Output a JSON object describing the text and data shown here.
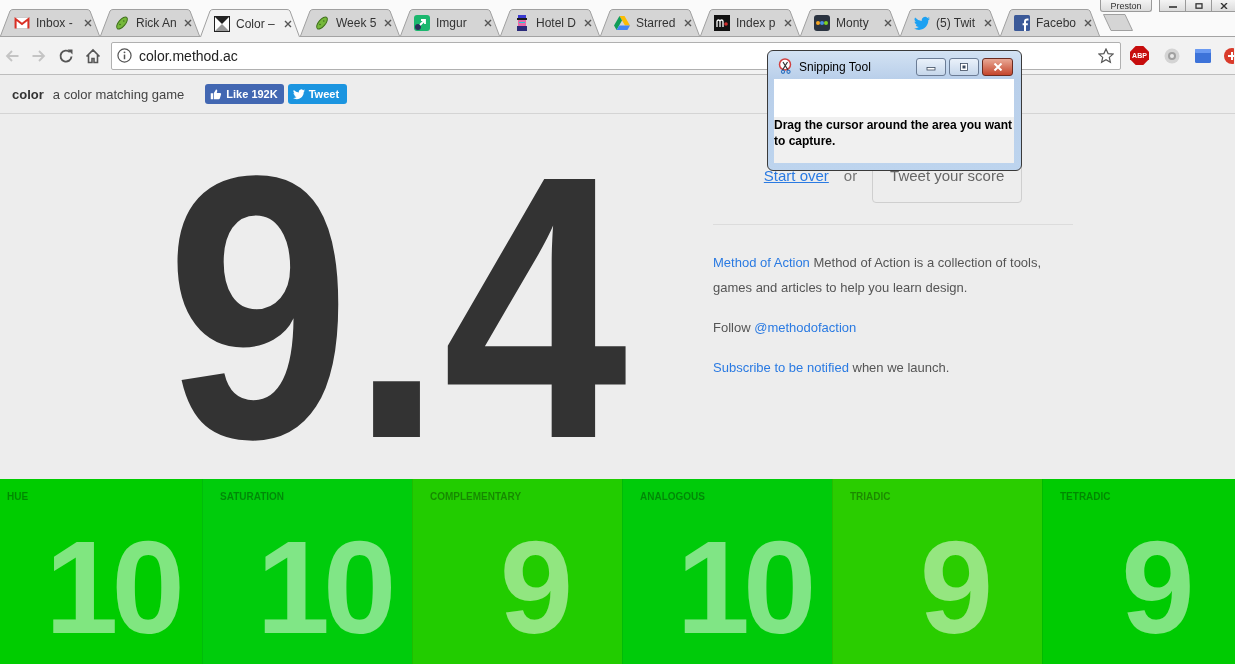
{
  "browser": {
    "tabs": [
      {
        "title": "Inbox -",
        "selected": false
      },
      {
        "title": "Rick An",
        "selected": false
      },
      {
        "title": "Color –",
        "selected": true
      },
      {
        "title": "Week 5",
        "selected": false
      },
      {
        "title": "Imgur",
        "selected": false
      },
      {
        "title": "Hotel D",
        "selected": false
      },
      {
        "title": "Starred",
        "selected": false
      },
      {
        "title": "Index p",
        "selected": false
      },
      {
        "title": "Monty",
        "selected": false
      },
      {
        "title": "(5) Twit",
        "selected": false
      },
      {
        "title": "Facebo",
        "selected": false
      }
    ],
    "profile": "Preston",
    "back": {
      "disabled": true
    },
    "forward": {
      "disabled": true
    },
    "address": "color.method.ac",
    "extension_label": "ABP"
  },
  "header": {
    "logo": "color",
    "tagline": "a color matching game",
    "like": {
      "label": "Like",
      "count": "192K"
    },
    "tweet": "Tweet"
  },
  "score": "9.4",
  "actions": {
    "start_over": "Start over",
    "separator": "or",
    "tweet_score": "Tweet your score"
  },
  "about": [
    {
      "parts": [
        {
          "kind": "link",
          "text": "Method of Action"
        },
        {
          "kind": "text",
          "text": "Method of Action is a collection of tools, games and articles to help you learn design."
        }
      ]
    },
    {
      "parts": [
        {
          "kind": "text",
          "text": "Follow"
        },
        {
          "kind": "link",
          "text": "@methodofaction"
        }
      ]
    },
    {
      "parts": [
        {
          "kind": "link",
          "text": "Subscribe to be notified"
        },
        {
          "kind": "text",
          "text": "when we launch."
        }
      ]
    }
  ],
  "scores": [
    {
      "label": "HUE",
      "value": "10",
      "color": "#00cc00"
    },
    {
      "label": "SATURATION",
      "value": "10",
      "color": "#00cc0c"
    },
    {
      "label": "COMPLEMENTARY",
      "value": "9",
      "color": "#22cc00"
    },
    {
      "label": "ANALOGOUS",
      "value": "10",
      "color": "#00cb0a"
    },
    {
      "label": "TRIADIC",
      "value": "9",
      "color": "#2acd00"
    },
    {
      "label": "TETRADIC",
      "value": "9",
      "color": "#00cb02"
    }
  ],
  "snipping_tool": {
    "title": "Snipping Tool",
    "message": "Drag the cursor around the area you want to capture."
  }
}
